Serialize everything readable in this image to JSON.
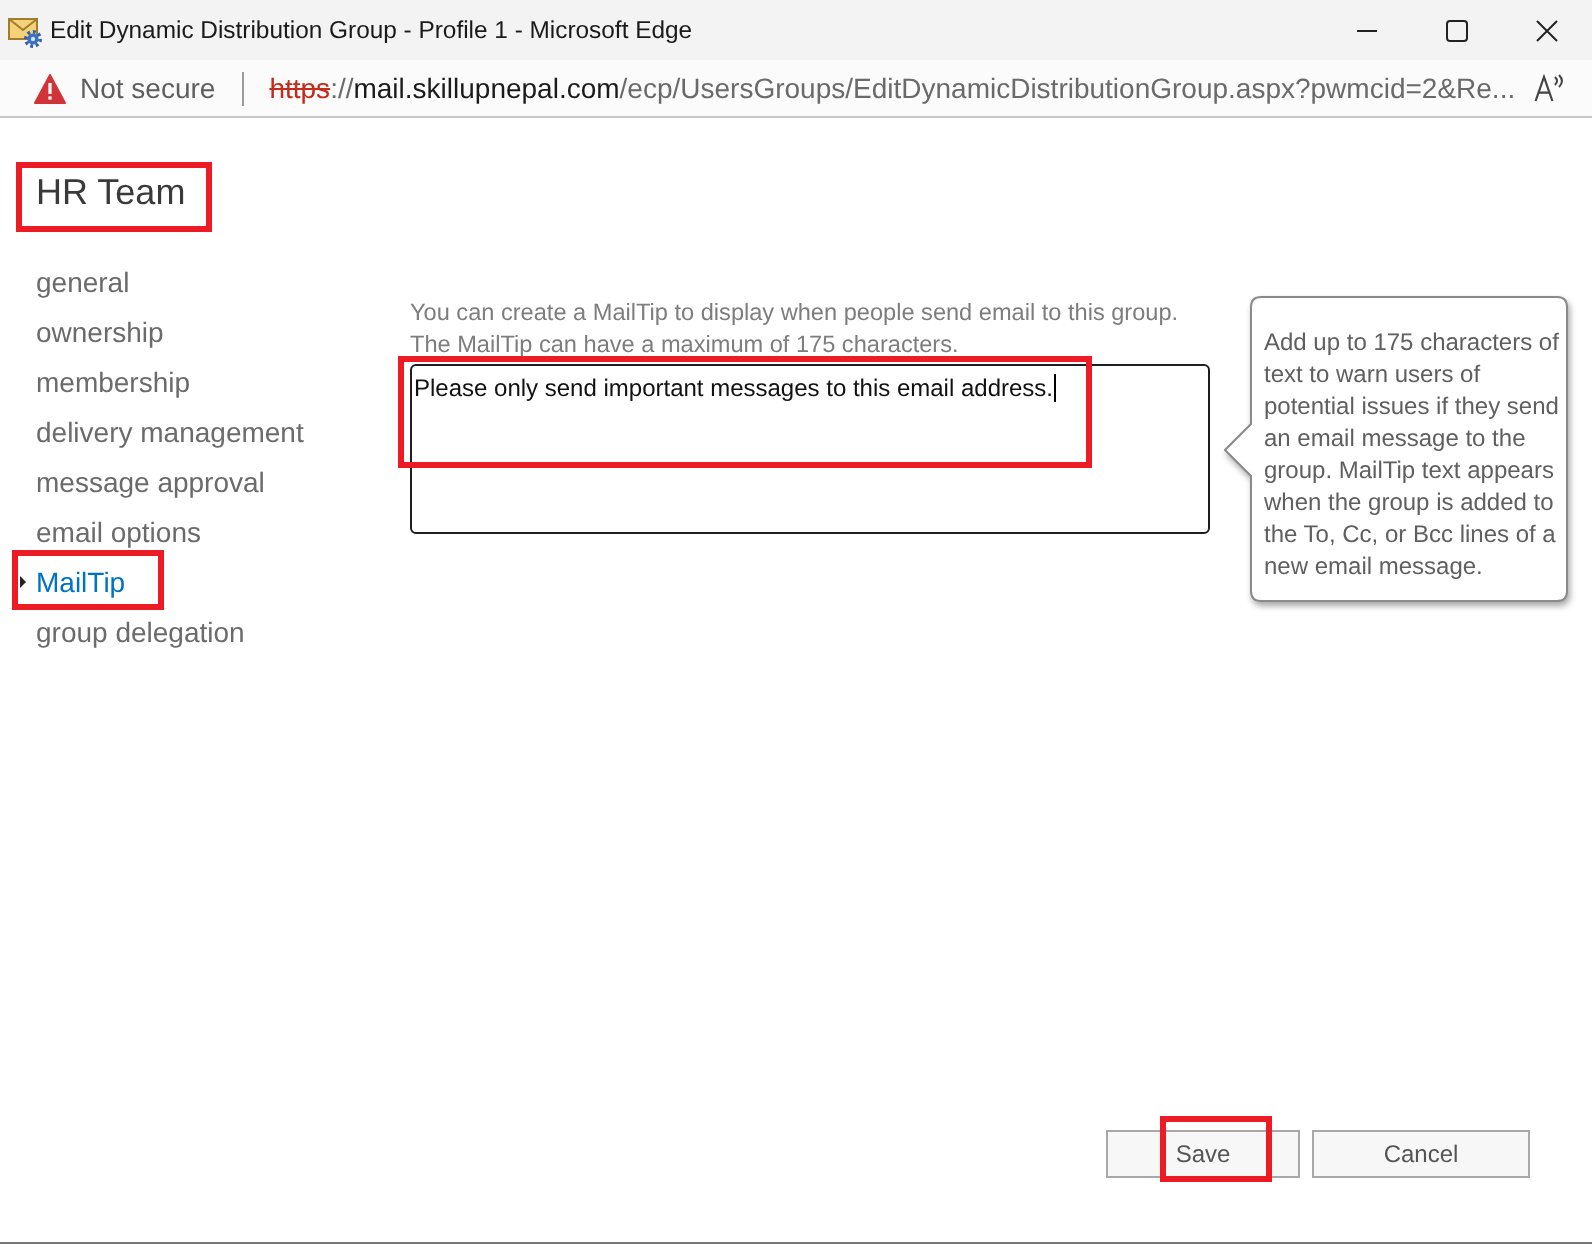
{
  "window": {
    "title": "Edit Dynamic Distribution Group - Profile 1 - Microsoft Edge"
  },
  "address_bar": {
    "secure": false,
    "security_label": "Not secure",
    "url": {
      "scheme": "https",
      "separator": "://",
      "host": "mail.skillupnepal.com",
      "path": "/ecp/UsersGroups/EditDynamicDistributionGroup.aspx?pwmcid=2&Re..."
    }
  },
  "page": {
    "title": "HR Team",
    "highlighted": true
  },
  "nav": [
    {
      "label": "general",
      "selected": false,
      "highlighted": false
    },
    {
      "label": "ownership",
      "selected": false,
      "highlighted": false
    },
    {
      "label": "membership",
      "selected": false,
      "highlighted": false
    },
    {
      "label": "delivery management",
      "selected": false,
      "highlighted": false
    },
    {
      "label": "message approval",
      "selected": false,
      "highlighted": false
    },
    {
      "label": "email options",
      "selected": false,
      "highlighted": false
    },
    {
      "label": "MailTip",
      "selected": true,
      "highlighted": true
    },
    {
      "label": "group delegation",
      "selected": false,
      "highlighted": false
    }
  ],
  "mailtip": {
    "description": [
      "You can create a MailTip to display when people send email to this group.",
      "The MailTip can have a maximum of 175 characters."
    ],
    "value": "Please only send important messages to this email address.",
    "focused": true,
    "highlighted": true
  },
  "tooltip": {
    "text": "Add up to 175 characters of text to warn users of potential issues if they send an email message to the group. MailTip text appears when the group is added to the To, Cc, or Bcc lines of a new email message."
  },
  "buttons": [
    {
      "label": "Save",
      "highlighted": true
    },
    {
      "label": "Cancel",
      "highlighted": false
    }
  ]
}
